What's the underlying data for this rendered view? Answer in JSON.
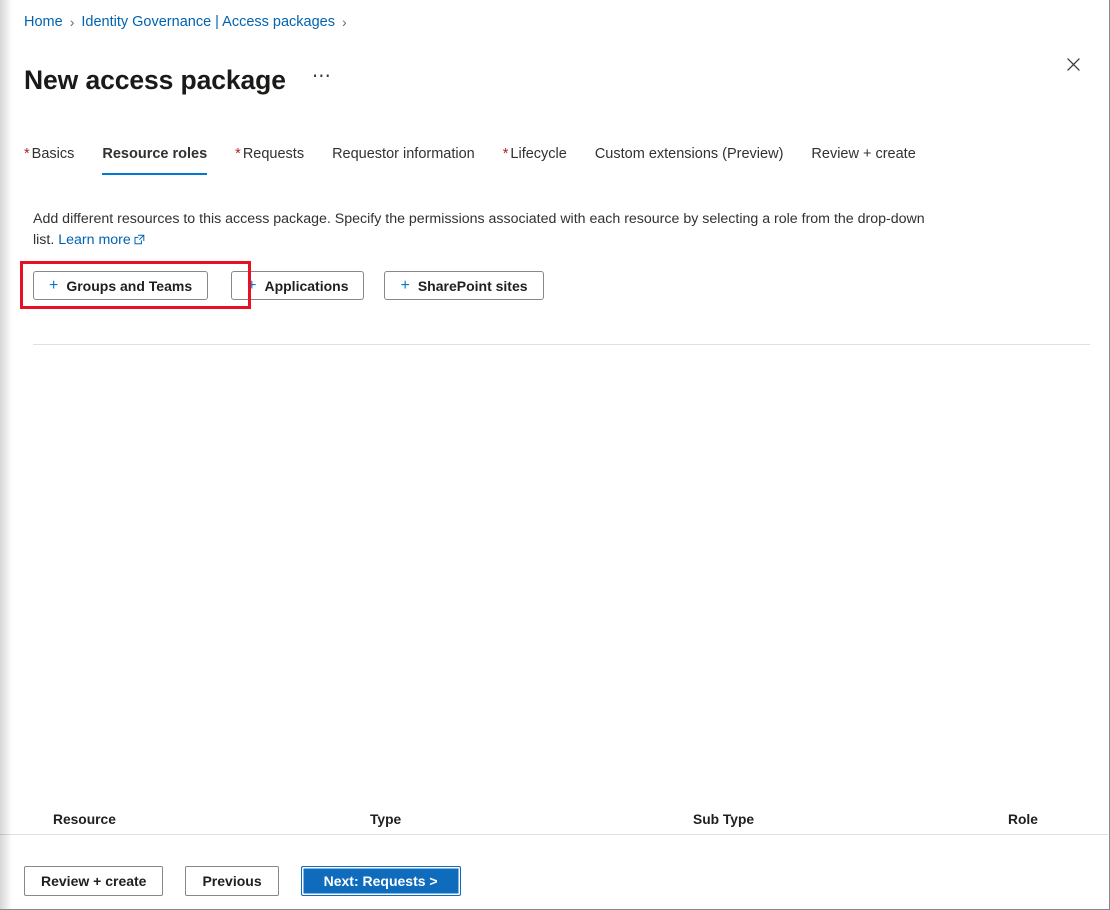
{
  "breadcrumb": {
    "items": [
      {
        "label": "Home",
        "separator": "›"
      },
      {
        "label": "Identity Governance | Access packages",
        "separator": "›"
      }
    ]
  },
  "header": {
    "title": "New access package",
    "more_menu_label": "⋯",
    "close_icon": "close-icon"
  },
  "tabs": [
    {
      "label": "Basics",
      "required": true,
      "active": false
    },
    {
      "label": "Resource roles",
      "required": false,
      "active": true
    },
    {
      "label": "Requests",
      "required": true,
      "active": false
    },
    {
      "label": "Requestor information",
      "required": false,
      "active": false
    },
    {
      "label": "Lifecycle",
      "required": true,
      "active": false
    },
    {
      "label": "Custom extensions (Preview)",
      "required": false,
      "active": false
    },
    {
      "label": "Review + create",
      "required": false,
      "active": false
    }
  ],
  "description": {
    "text": "Add different resources to this access package. Specify the permissions associated with each resource by selecting a role from the drop-down list.",
    "link_label": "Learn more"
  },
  "add_buttons": [
    {
      "label": "Groups and Teams",
      "icon": "plus-icon"
    },
    {
      "label": "Applications",
      "icon": "plus-icon"
    },
    {
      "label": "SharePoint sites",
      "icon": "plus-icon"
    }
  ],
  "resource_table": {
    "columns": [
      "Resource",
      "Type",
      "Sub Type",
      "Role"
    ],
    "rows": []
  },
  "footer": {
    "review_create_label": "Review + create",
    "previous_label": "Previous",
    "next_label": "Next: Requests >"
  },
  "colors": {
    "accent": "#0078d4",
    "link": "#0063b1",
    "required_star": "#a4262c",
    "primary_button": "#0f6cbd",
    "highlight_annotation": "#e81123",
    "divider": "#e1dfdd"
  }
}
